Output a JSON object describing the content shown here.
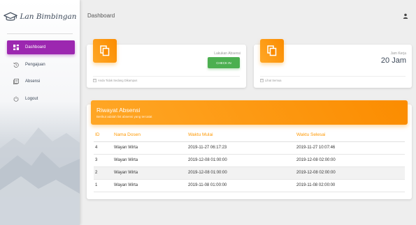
{
  "brand": {
    "name": "Lan Bimbingan",
    "icon": "graduation-cap-icon"
  },
  "sidebar": {
    "items": [
      {
        "label": "Dashboard",
        "icon": "dashboard-icon",
        "active": true
      },
      {
        "label": "Pengajuan",
        "icon": "history-icon",
        "active": false
      },
      {
        "label": "Absensi",
        "icon": "library-icon",
        "active": false
      },
      {
        "label": "Logout",
        "icon": "power-icon",
        "active": false
      }
    ]
  },
  "header": {
    "title": "Dashboard",
    "user_icon": "person-icon"
  },
  "attendance_card": {
    "icon": "content-copy-icon",
    "label": "Lakukan Absensi",
    "button_label": "CHECK IN",
    "footer": "Anda Tidak Sedang Dikampus",
    "footer_icon": "calendar-icon"
  },
  "work_hours_card": {
    "icon": "content-copy-icon",
    "label": "Jam Kerja",
    "value": "20 Jam",
    "footer": "Lihat Semua",
    "footer_icon": "calendar-icon"
  },
  "attendance_history": {
    "title": "Riwayat Absensi",
    "subtitle": "Berikut adalah list absensi yang tercatat",
    "columns": [
      "ID",
      "Nama Dosen",
      "Waktu Mulai",
      "Waktu Selesai"
    ],
    "rows": [
      [
        "4",
        "Wayan Wirta",
        "2019-11-27 06:17:23",
        "2019-11-27 10:07:46"
      ],
      [
        "3",
        "Wayan Wirta",
        "2019-12-08 01:00:00",
        "2019-12-08 02:00:00"
      ],
      [
        "2",
        "Wayan Wirta",
        "2019-12-08 01:00:00",
        "2019-12-08 02:00:00"
      ],
      [
        "1",
        "Wayan Wirta",
        "2019-11-08 01:00:00",
        "2019-11-08 02:00:00"
      ]
    ]
  },
  "colors": {
    "accent": "#9c27b0",
    "header_orange": "#ff9800",
    "checkin_green": "#4caf50"
  }
}
